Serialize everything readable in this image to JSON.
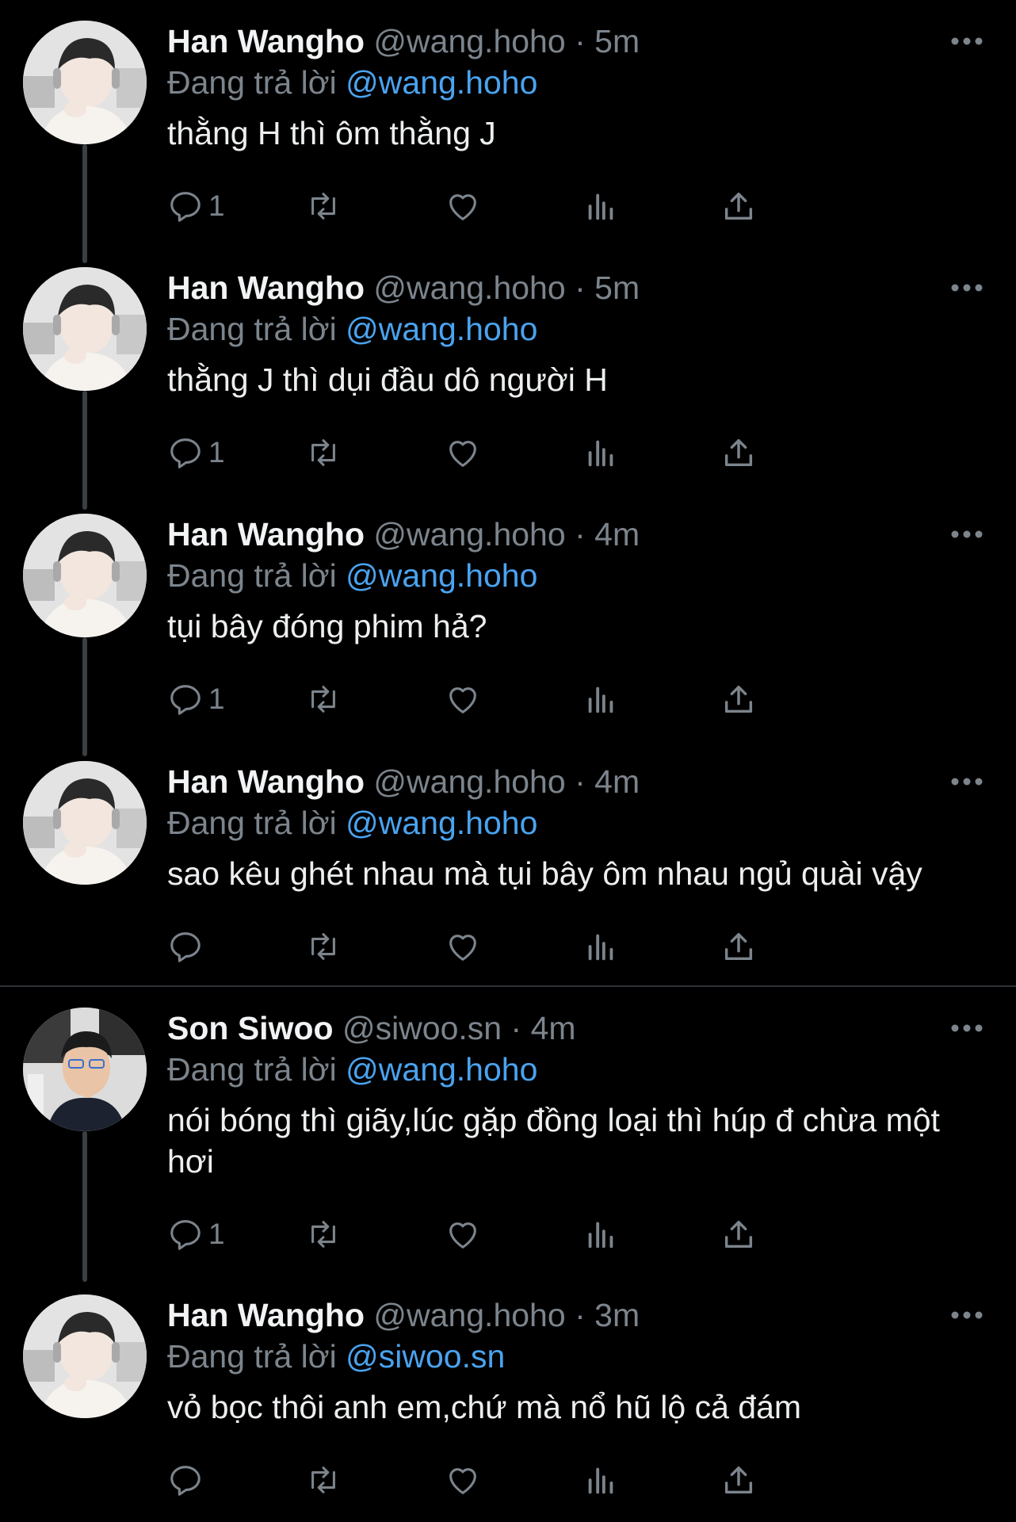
{
  "colors": {
    "background": "#000000",
    "name": "#f1f3f4",
    "secondary": "#7c848c",
    "mention": "#4aa3ef",
    "thread_line": "#3a3f44"
  },
  "icons": {
    "reply": "speech-bubble-icon",
    "retweet": "retweet-arrows-icon",
    "like": "heart-outline-icon",
    "views": "bar-chart-icon",
    "share": "share-upload-icon",
    "more": "three-dots-icon"
  },
  "tweets": [
    {
      "name": "Han Wangho",
      "handle": "@wang.hoho",
      "dot": "·",
      "time": "5m",
      "reply_prefix": "Đang trả lời",
      "reply_to": "@wang.hoho",
      "text": "thằng H thì ôm thằng J",
      "reply_count": "1"
    },
    {
      "name": "Han Wangho",
      "handle": "@wang.hoho",
      "dot": "·",
      "time": "5m",
      "reply_prefix": "Đang trả lời",
      "reply_to": "@wang.hoho",
      "text": "thằng J thì dụi đầu dô người H",
      "reply_count": "1"
    },
    {
      "name": "Han Wangho",
      "handle": "@wang.hoho",
      "dot": "·",
      "time": "4m",
      "reply_prefix": "Đang trả lời",
      "reply_to": "@wang.hoho",
      "text": "tụi bây đóng phim hả?",
      "reply_count": "1"
    },
    {
      "name": "Han Wangho",
      "handle": "@wang.hoho",
      "dot": "·",
      "time": "4m",
      "reply_prefix": "Đang trả lời",
      "reply_to": "@wang.hoho",
      "text": "sao kêu ghét nhau mà tụi bây ôm nhau ngủ quài vậy",
      "reply_count": ""
    },
    {
      "name": "Son Siwoo",
      "handle": "@siwoo.sn",
      "dot": "·",
      "time": "4m",
      "reply_prefix": "Đang trả lời",
      "reply_to": "@wang.hoho",
      "text": "nói bóng thì giãy,lúc gặp đồng loại thì húp đ chừa một hơi",
      "reply_count": "1"
    },
    {
      "name": "Han Wangho",
      "handle": "@wang.hoho",
      "dot": "·",
      "time": "3m",
      "reply_prefix": "Đang trả lời",
      "reply_to": "@siwoo.sn",
      "text": "vỏ bọc thôi anh em,chứ mà nổ hũ lộ cả đám",
      "reply_count": ""
    }
  ]
}
